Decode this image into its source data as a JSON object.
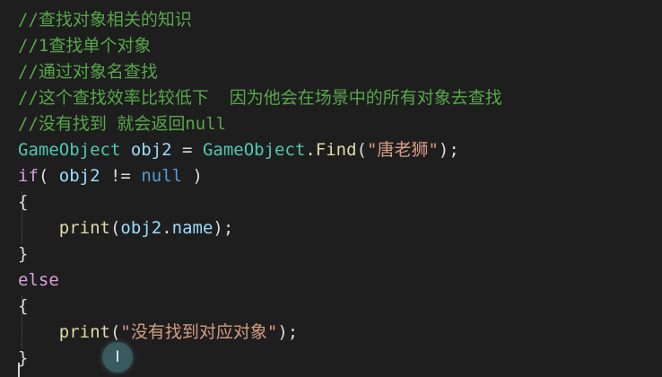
{
  "editor": {
    "lines": [
      {
        "tokens": [
          {
            "t": "//查找对象相关的知识",
            "c": "comment"
          }
        ]
      },
      {
        "tokens": [
          {
            "t": "//1查找单个对象",
            "c": "comment"
          }
        ]
      },
      {
        "tokens": [
          {
            "t": "//通过对象名查找",
            "c": "comment"
          }
        ]
      },
      {
        "tokens": [
          {
            "t": "//这个查找效率比较低下  因为他会在场景中的所有对象去查找",
            "c": "comment"
          }
        ]
      },
      {
        "tokens": [
          {
            "t": "//没有找到 就会返回null",
            "c": "comment"
          }
        ]
      },
      {
        "tokens": [
          {
            "t": "GameObject",
            "c": "type"
          },
          {
            "t": " ",
            "c": "plain"
          },
          {
            "t": "obj2",
            "c": "ident"
          },
          {
            "t": " = ",
            "c": "plain"
          },
          {
            "t": "GameObject",
            "c": "type"
          },
          {
            "t": ".",
            "c": "plain"
          },
          {
            "t": "Find",
            "c": "method"
          },
          {
            "t": "(",
            "c": "plain"
          },
          {
            "t": "\"唐老狮\"",
            "c": "string"
          },
          {
            "t": ");",
            "c": "plain"
          }
        ]
      },
      {
        "tokens": [
          {
            "t": "if",
            "c": "kw-ctrl"
          },
          {
            "t": "( ",
            "c": "plain"
          },
          {
            "t": "obj2",
            "c": "ident"
          },
          {
            "t": " != ",
            "c": "plain"
          },
          {
            "t": "null",
            "c": "kw"
          },
          {
            "t": " )",
            "c": "plain"
          }
        ]
      },
      {
        "tokens": [
          {
            "t": "{",
            "c": "plain"
          }
        ]
      },
      {
        "tokens": [
          {
            "t": "    ",
            "c": "plain"
          },
          {
            "t": "print",
            "c": "method"
          },
          {
            "t": "(",
            "c": "plain"
          },
          {
            "t": "obj2",
            "c": "ident"
          },
          {
            "t": ".",
            "c": "plain"
          },
          {
            "t": "name",
            "c": "ident"
          },
          {
            "t": ");",
            "c": "plain"
          }
        ]
      },
      {
        "tokens": [
          {
            "t": "}",
            "c": "plain"
          }
        ]
      },
      {
        "tokens": [
          {
            "t": "else",
            "c": "kw-ctrl"
          }
        ]
      },
      {
        "tokens": [
          {
            "t": "{",
            "c": "plain"
          }
        ]
      },
      {
        "tokens": [
          {
            "t": "    ",
            "c": "plain"
          },
          {
            "t": "print",
            "c": "method"
          },
          {
            "t": "(",
            "c": "plain"
          },
          {
            "t": "\"没有找到对应对象\"",
            "c": "string"
          },
          {
            "t": ");",
            "c": "plain"
          }
        ]
      },
      {
        "tokens": [
          {
            "t": "}",
            "c": "plain"
          }
        ]
      }
    ]
  },
  "colors": {
    "background": "#1e1e1e",
    "comment": "#57a64a",
    "type": "#4ec9b0",
    "identifier": "#9cdcfe",
    "method": "#dcdcaa",
    "string": "#d69d85",
    "control_keyword": "#d8a0df",
    "keyword": "#569cd6",
    "plain": "#dcdcdc"
  },
  "mouse_pointer": {
    "label": "I"
  }
}
